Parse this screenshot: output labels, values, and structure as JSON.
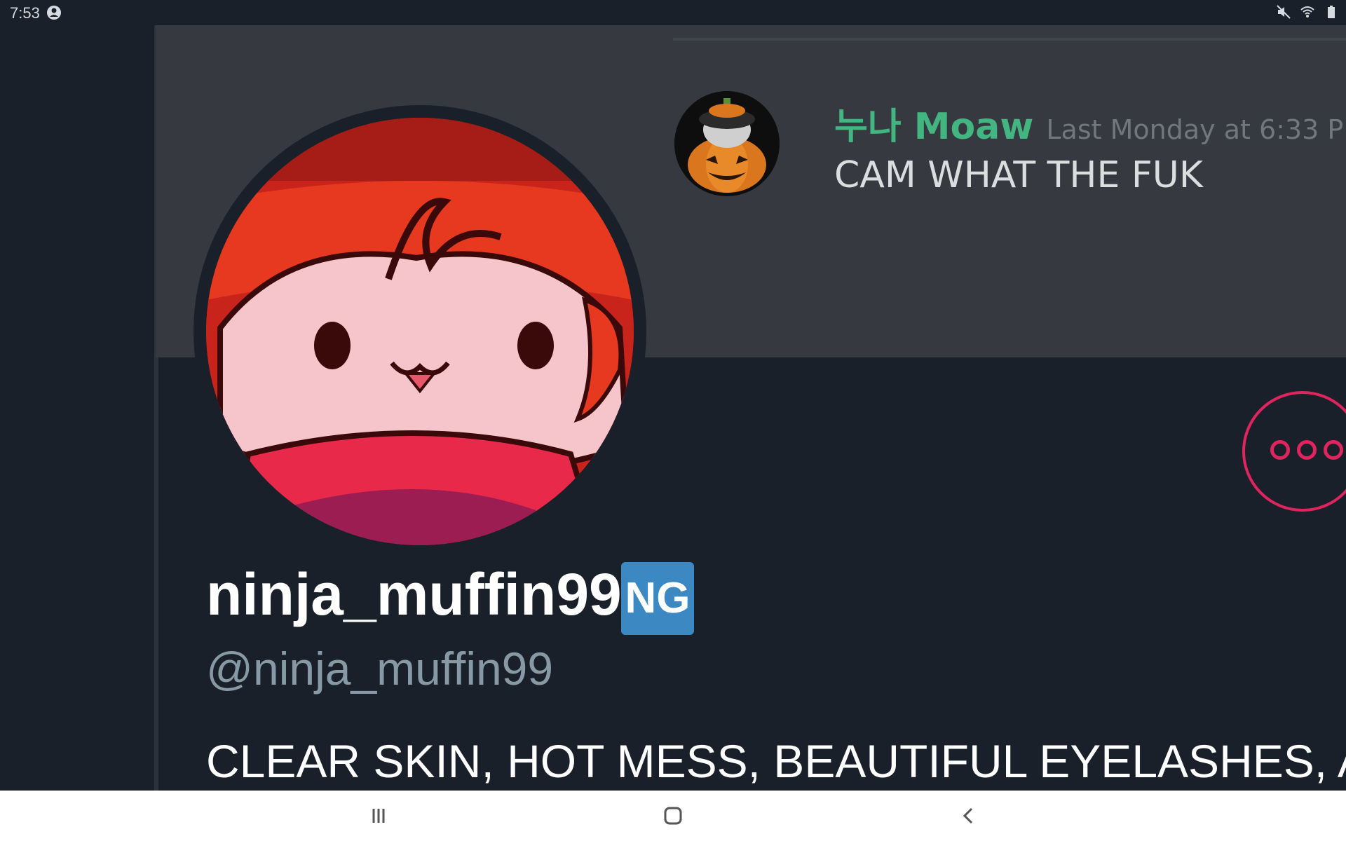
{
  "status_bar": {
    "time": "7:53",
    "left_icons": [
      "user-icon"
    ],
    "right_icons": [
      "mute-icon",
      "wifi-icon",
      "battery-icon"
    ]
  },
  "message": {
    "author": "누나 Moaw",
    "timestamp": "Last Monday at 6:33 P",
    "text": "CAM WHAT THE FUK",
    "author_color": "#43b581"
  },
  "profile": {
    "display_name": "ninja_muffin99",
    "badge": "NG",
    "handle": "@ninja_muffin99",
    "bio": "CLEAR SKIN, HOT MESS, BEAUTIFUL EYELASHES, ASI",
    "accent_color": "#e0245e",
    "badge_color": "#3b88c3"
  },
  "nav_bar": {
    "buttons": [
      "recents-icon",
      "home-icon",
      "back-icon"
    ]
  }
}
